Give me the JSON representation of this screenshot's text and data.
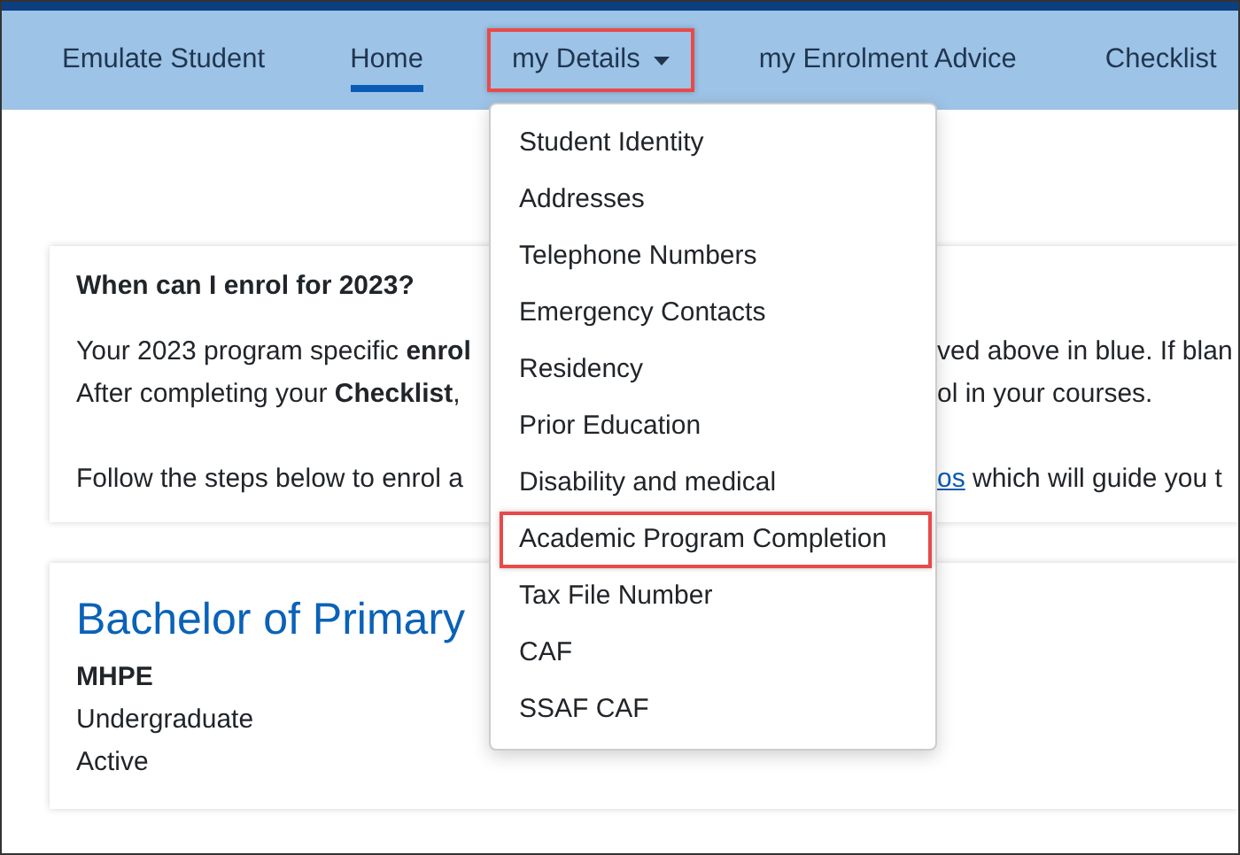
{
  "nav": {
    "items": [
      {
        "label": "Emulate Student",
        "kind": "link",
        "selected": false,
        "highlighted": false
      },
      {
        "label": "Home",
        "kind": "link",
        "selected": true,
        "highlighted": false
      },
      {
        "label": "my Details",
        "kind": "dropdown",
        "selected": false,
        "highlighted": true
      },
      {
        "label": "my Enrolment Advice",
        "kind": "link",
        "selected": false,
        "highlighted": false
      },
      {
        "label": "Checklist",
        "kind": "link",
        "selected": false,
        "highlighted": false
      }
    ]
  },
  "dropdown": {
    "items": [
      {
        "label": "Student Identity",
        "highlighted": false
      },
      {
        "label": "Addresses",
        "highlighted": false
      },
      {
        "label": "Telephone Numbers",
        "highlighted": false
      },
      {
        "label": "Emergency Contacts",
        "highlighted": false
      },
      {
        "label": "Residency",
        "highlighted": false
      },
      {
        "label": "Prior Education",
        "highlighted": false
      },
      {
        "label": "Disability and medical",
        "highlighted": false
      },
      {
        "label": "Academic Program Completion",
        "highlighted": true
      },
      {
        "label": "Tax File Number",
        "highlighted": false
      },
      {
        "label": "CAF",
        "highlighted": false
      },
      {
        "label": "SSAF CAF",
        "highlighted": false
      }
    ]
  },
  "notice": {
    "heading": "When can I enrol for 2023?",
    "paragraphs": [
      {
        "lines": [
          {
            "left": "Your 2023 program specific **enrol**",
            "right": "ved above in blue. If blan"
          },
          {
            "left": "After completing your **Checklist**,",
            "right": "ol in your courses."
          }
        ]
      },
      {
        "lines": [
          {
            "left": "Follow the steps below to enrol a",
            "link": "os",
            "right": " which will guide you t"
          }
        ]
      }
    ]
  },
  "program": {
    "title": "Bachelor of Primary",
    "code": "MHPE",
    "level": "Undergraduate",
    "status": "Active"
  }
}
